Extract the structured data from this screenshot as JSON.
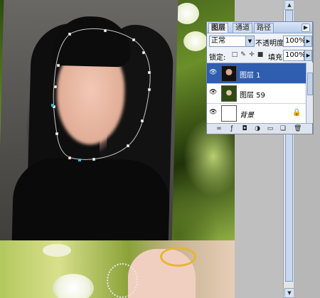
{
  "layers_panel": {
    "tabs": [
      {
        "label": "图层",
        "active": true
      },
      {
        "label": "通道",
        "active": false
      },
      {
        "label": "路径",
        "active": false
      }
    ],
    "blend_mode": "正常",
    "opacity_label": "不透明度:",
    "opacity_value": "100%",
    "lock_label": "锁定:",
    "fill_label": "填充:",
    "fill_value": "100%",
    "layers": [
      {
        "name": "图层 1",
        "selected": true,
        "visible": true
      },
      {
        "name": "图层 59",
        "selected": false,
        "visible": true
      },
      {
        "name": "背景",
        "selected": false,
        "visible": true,
        "locked": true
      }
    ],
    "menu_icon": "panel-menu-arrow-icon",
    "bottom_buttons": [
      "link-icon",
      "style-icon",
      "mask-icon",
      "adjustment-icon",
      "group-icon",
      "new-layer-icon",
      "trash-icon"
    ]
  },
  "colors": {
    "selected_layer": "#2f5db0",
    "panel_bg": "#eef1f7",
    "accent_gold": "#e4b733"
  }
}
